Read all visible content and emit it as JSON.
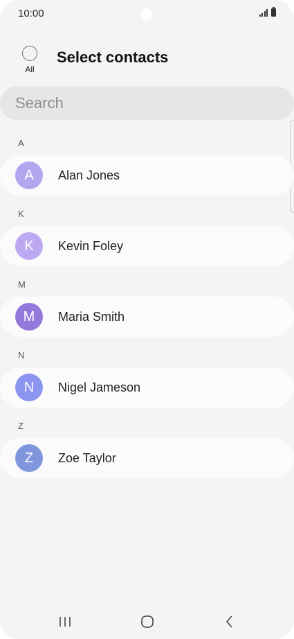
{
  "status_bar": {
    "time": "10:00"
  },
  "header": {
    "all_label": "All",
    "title": "Select contacts"
  },
  "search": {
    "placeholder": "Search"
  },
  "sections": [
    {
      "letter": "A",
      "contact": {
        "initial": "A",
        "name": "Alan Jones",
        "avatar_color": "#b3a6ef"
      }
    },
    {
      "letter": "K",
      "contact": {
        "initial": "K",
        "name": "Kevin Foley",
        "avatar_color": "#bda8f2"
      }
    },
    {
      "letter": "M",
      "contact": {
        "initial": "M",
        "name": "Maria Smith",
        "avatar_color": "#9479dc"
      }
    },
    {
      "letter": "N",
      "contact": {
        "initial": "N",
        "name": "Nigel Jameson",
        "avatar_color": "#8b95ef"
      }
    },
    {
      "letter": "Z",
      "contact": {
        "initial": "Z",
        "name": "Zoe Taylor",
        "avatar_color": "#7f96dc"
      }
    }
  ],
  "nav": {
    "recents_icon": "recents-icon",
    "home_icon": "home-icon",
    "back_icon": "back-icon"
  }
}
